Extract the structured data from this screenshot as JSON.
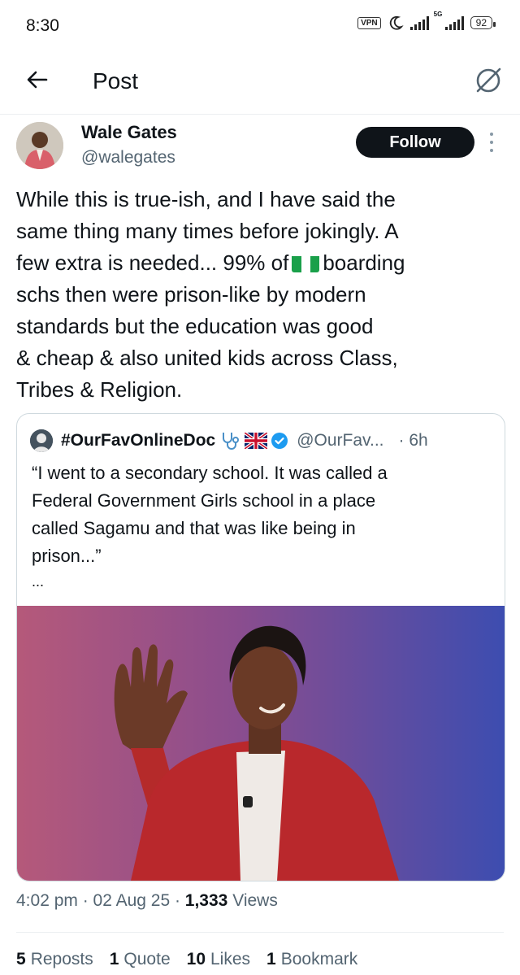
{
  "status_bar": {
    "time": "8:30",
    "vpn": "VPN",
    "network": "5G",
    "battery": "92"
  },
  "header": {
    "title": "Post"
  },
  "post": {
    "author_name": "Wale Gates",
    "author_handle": "@walegates",
    "follow_label": "Follow",
    "text_lines": [
      "While this is true-ish, and I have said the",
      "same thing many times before jokingly. A",
      "few extra is needed... 99% of",
      "boarding",
      "schs then were prison-like by modern",
      "standards but the education was good",
      "& cheap & also united kids across Class,",
      "Tribes & Religion."
    ],
    "flag_colors": [
      "#1aa04a",
      "#ffffff",
      "#1aa04a"
    ],
    "timestamp": "4:02 pm · 02 Aug 25 · ",
    "views_count": "1,333",
    "views_label": " Views"
  },
  "quoted_post": {
    "author_name": "#OurFavOnlineDoc",
    "author_handle": "@OurFav...",
    "time_ago": "· 6h",
    "emojis": [
      "stethoscope-icon",
      "uk-flag-icon",
      "verified-badge-icon"
    ],
    "verified_color": "#1d9bf0",
    "text_lines": [
      "“I went to a secondary school. It was called a",
      "Federal Government Girls school in a place",
      "called Sagamu and that was like being in",
      "prison...”"
    ],
    "ellipsis": "..."
  },
  "stats": [
    {
      "count": "5",
      "label": "Reposts"
    },
    {
      "count": "1",
      "label": "Quote"
    },
    {
      "count": "10",
      "label": "Likes"
    },
    {
      "count": "1",
      "label": "Bookmark"
    }
  ]
}
